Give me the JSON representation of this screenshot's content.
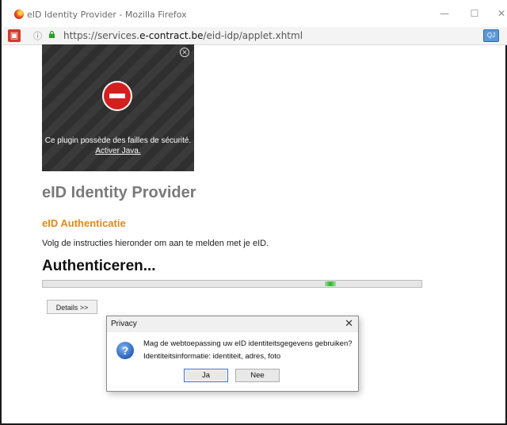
{
  "window": {
    "title": "eID Identity Provider - Mozilla Firefox",
    "minimize": "—",
    "maximize": "☐",
    "close": "✕"
  },
  "urlbar": {
    "info": "ⓘ",
    "url_prefix": "https://services.",
    "url_domain": "e-contract.be",
    "url_path": "/eid-idp/applet.xhtml",
    "addon": "QJ"
  },
  "applet": {
    "close": "✕",
    "message": "Ce plugin possède des failles de sécurité.",
    "link": "Activer Java."
  },
  "page": {
    "title": "eID Identity Provider",
    "subtitle": "eID Authenticatie",
    "instruction": "Volg de instructies hieronder om aan te melden met je eID.",
    "status": "Authenticeren...",
    "progress_fraction": 0.76,
    "details_label": "Details >>"
  },
  "dialog": {
    "title": "Privacy",
    "close": "✕",
    "icon": "?",
    "question": "Mag de webtoepassing uw eID identiteitsgegevens gebruiken?",
    "info": "Identiteitsinformatie: identiteit, adres, foto",
    "yes_label": "Ja",
    "no_label": "Nee"
  }
}
